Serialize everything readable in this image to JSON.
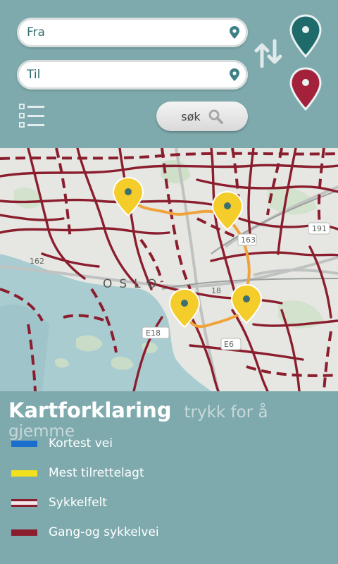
{
  "search": {
    "from_placeholder": "Fra",
    "to_placeholder": "Til",
    "search_label": "søk"
  },
  "map": {
    "labels": {
      "oslo": "OSLO",
      "road_191": "191",
      "road_163": "163",
      "road_e18": "E18",
      "road_e6": "E6",
      "road_162": "162",
      "road_18": "18"
    }
  },
  "legend": {
    "title": "Kartforklaring",
    "hint": "trykk for å gjemme",
    "items": [
      {
        "label": "Kortest vei",
        "color": "#1a6fcc"
      },
      {
        "label": "Mest tilrettelagt",
        "color": "#f2e11c"
      },
      {
        "label": "Sykkelfelt",
        "color": "#8b1e2e"
      },
      {
        "label": "Gang-og sykkelvei",
        "color": "#8b1e2e"
      }
    ]
  },
  "colors": {
    "background": "#7eaaad",
    "marker_from": "#1f6b6c",
    "marker_to": "#a3213a",
    "bike_route": "#8b1e2e",
    "suggested_route": "#f0a33a",
    "poi_marker": "#f4cd2a"
  }
}
